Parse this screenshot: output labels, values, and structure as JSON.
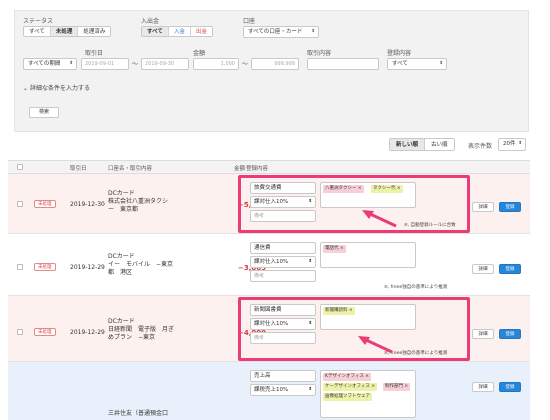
{
  "filters": {
    "status": {
      "label": "ステータス",
      "options": [
        "すべて",
        "未処理",
        "処理済み"
      ],
      "selected": "未処理"
    },
    "inout": {
      "label": "入出金",
      "options": [
        "すべて",
        "入金",
        "出金"
      ],
      "selected": "すべて"
    },
    "account": {
      "label": "口座",
      "value": "すべての口座・カード"
    },
    "period": {
      "value": "すべての期間"
    },
    "date": {
      "label": "取引日",
      "from_placeholder": "2019-09-01",
      "to_placeholder": "2019-09-30",
      "tilde": "〜"
    },
    "amount": {
      "label": "金額",
      "from_placeholder": "1,000",
      "to_placeholder": "999,999",
      "tilde": "〜"
    },
    "content": {
      "label": "取引内容",
      "placeholder": ""
    },
    "reg": {
      "label": "登録内容",
      "value": "すべて"
    },
    "more_conditions": "詳細な条件を入力する",
    "search_button": "検索"
  },
  "sort": {
    "options": [
      "新しい順",
      "古い順"
    ],
    "selected": "新しい順",
    "count_label": "表示件数",
    "count_value": "20件"
  },
  "table": {
    "headers": [
      "取引日",
      "口座名・取引内容",
      "金額",
      "登録内容"
    ],
    "rows": [
      {
        "status": "未処理",
        "date": "2019-12-30",
        "account": [
          "DCカード",
          "株式会社八重洲タクシ",
          "ー　東京都"
        ],
        "amount": "−5,000",
        "category": "旅費交通費",
        "tax": "課対仕入10%",
        "memo_placeholder": "備考",
        "tags": [
          "八重洲タクシー ×",
          "タクシー代 ×"
        ],
        "note": "自動登録ルールに合致",
        "detail": "詳細",
        "register": "登録"
      },
      {
        "status": "未処理",
        "date": "2019-12-29",
        "account": [
          "DCカード",
          "イー　モバイル　−東京",
          "都　港区"
        ],
        "amount": "−3,885",
        "category": "通信費",
        "tax": "課対仕入10%",
        "memo_placeholder": "備考",
        "tags": [
          "電話代 ×"
        ],
        "note": "freee独自の基準により推測",
        "detail": "詳細",
        "register": "登録"
      },
      {
        "status": "未処理",
        "date": "2019-12-29",
        "account": [
          "DCカード",
          "日経新聞　電子版　月ぎ",
          "めプラン　−東京"
        ],
        "amount": "−4,000",
        "category": "新聞図書費",
        "tax": "課対仕入10%",
        "memo_placeholder": "備考",
        "tags": [
          "新聞購読料 ×"
        ],
        "note": "freee独自の基準により推測",
        "detail": "詳細",
        "register": "登録"
      },
      {
        "status": "",
        "date": "",
        "account": [
          "三井住友（普通預金口"
        ],
        "amount": "",
        "category": "売上高",
        "tax": "課税売上10%",
        "memo_placeholder": "",
        "tags": [
          "Kデザインオフィス ×",
          "ケーデザインオフィス ×",
          "制作部門 ×",
          "画像処理ソフトウェア"
        ],
        "note": "",
        "detail": "詳細",
        "register": "登録"
      }
    ]
  },
  "colors": {
    "highlight": "#e93c78",
    "register": "#2686d9",
    "amount": "#d33b3b"
  }
}
